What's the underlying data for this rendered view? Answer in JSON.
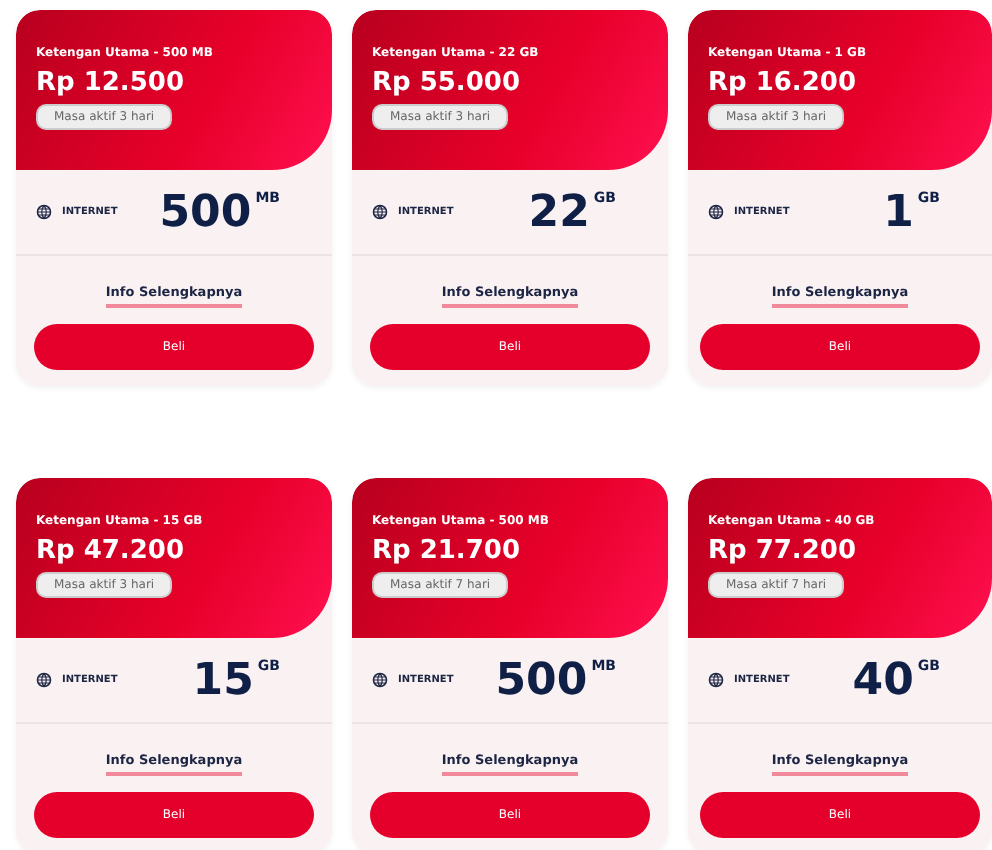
{
  "packages": [
    {
      "title": "Ketengan Utama - 500 MB",
      "price": "Rp 12.500",
      "validity": "Masa aktif 3 hari",
      "category": "INTERNET",
      "amount": "500",
      "unit": "MB",
      "link": "Info Selengkapnya",
      "button": "Beli"
    },
    {
      "title": "Ketengan Utama - 22 GB",
      "price": "Rp 55.000",
      "validity": "Masa aktif 3 hari",
      "category": "INTERNET",
      "amount": "22",
      "unit": "GB",
      "link": "Info Selengkapnya",
      "button": "Beli"
    },
    {
      "title": "Ketengan Utama - 1 GB",
      "price": "Rp 16.200",
      "validity": "Masa aktif 3 hari",
      "category": "INTERNET",
      "amount": "1",
      "unit": "GB",
      "link": "Info Selengkapnya",
      "button": "Beli"
    },
    {
      "title": "Ketengan Utama - 15 GB",
      "price": "Rp 47.200",
      "validity": "Masa aktif 3 hari",
      "category": "INTERNET",
      "amount": "15",
      "unit": "GB",
      "link": "Info Selengkapnya",
      "button": "Beli"
    },
    {
      "title": "Ketengan Utama - 500 MB",
      "price": "Rp 21.700",
      "validity": "Masa aktif 7 hari",
      "category": "INTERNET",
      "amount": "500",
      "unit": "MB",
      "link": "Info Selengkapnya",
      "button": "Beli"
    },
    {
      "title": "Ketengan Utama - 40 GB",
      "price": "Rp 77.200",
      "validity": "Masa aktif 7 hari",
      "category": "INTERNET",
      "amount": "40",
      "unit": "GB",
      "link": "Info Selengkapnya",
      "button": "Beli"
    }
  ]
}
